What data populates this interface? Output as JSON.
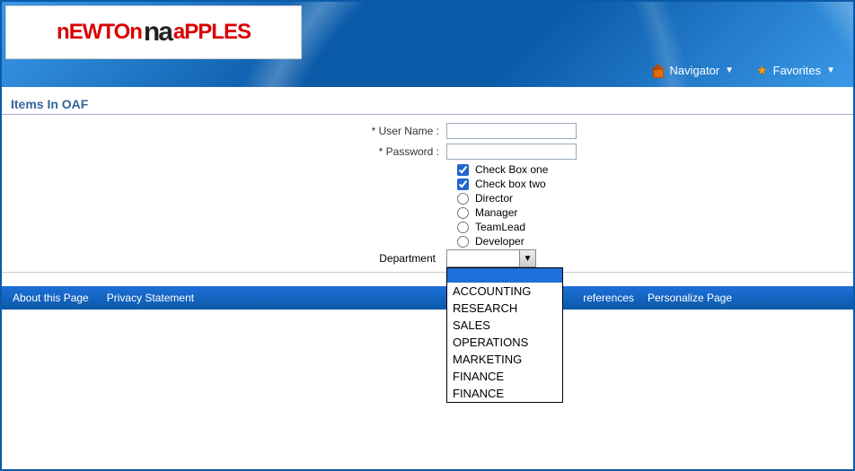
{
  "header": {
    "logo_part1": "nEWTOn",
    "logo_mid": "na",
    "logo_part2": "aPPLES",
    "menu": {
      "navigator": "Navigator",
      "favorites": "Favorites"
    }
  },
  "section_title": "Items In OAF",
  "form": {
    "username_label": "User Name :",
    "password_label": "Password :",
    "username_value": "",
    "password_value": "",
    "required_prefix": "*",
    "checkbox1_label": "Check Box one",
    "checkbox1_checked": true,
    "checkbox2_label": "Check box two",
    "checkbox2_checked": true,
    "radio_options": [
      "Director",
      "Manager",
      "TeamLead",
      "Developer"
    ],
    "radio_selected": null,
    "department_label": "Department",
    "department_selected": "",
    "department_options": [
      "",
      "ACCOUNTING",
      "RESEARCH",
      "SALES",
      "OPERATIONS",
      "MARKETING",
      "FINANCE",
      "FINANCE"
    ]
  },
  "footer": {
    "about": "About this Page",
    "privacy": "Privacy Statement",
    "preferences": "references",
    "personalize": "Personalize Page"
  }
}
